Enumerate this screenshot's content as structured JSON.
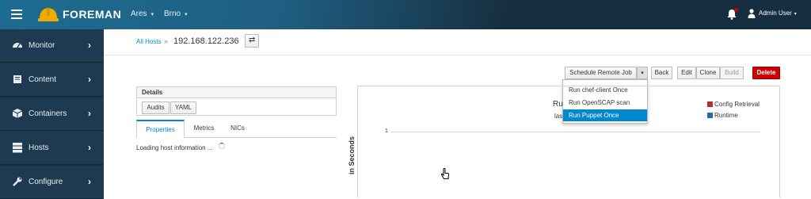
{
  "header": {
    "brand": "FOREMAN",
    "organization": "Ares",
    "location": "Brno",
    "user": "Admin User"
  },
  "sidebar": {
    "items": [
      {
        "label": "Monitor",
        "icon": "dashboard-icon"
      },
      {
        "label": "Content",
        "icon": "book-icon"
      },
      {
        "label": "Containers",
        "icon": "cube-icon"
      },
      {
        "label": "Hosts",
        "icon": "server-icon"
      },
      {
        "label": "Configure",
        "icon": "wrench-icon"
      }
    ]
  },
  "breadcrumb": {
    "parent": "All Hosts",
    "separator": "»",
    "current": "192.168.122.236"
  },
  "toolbar": {
    "schedule_label": "Schedule Remote Job",
    "back_label": "Back",
    "edit_label": "Edit",
    "clone_label": "Clone",
    "build_label": "Build",
    "delete_label": "Delete"
  },
  "dropdown": {
    "items": [
      {
        "label": "Run chef-client Once",
        "active": false
      },
      {
        "label": "Run OpenSCAP scan",
        "active": false
      },
      {
        "label": "Run Puppet Once",
        "active": true
      }
    ]
  },
  "details": {
    "heading": "Details",
    "audits_label": "Audits",
    "yaml_label": "YAML"
  },
  "tabs": [
    {
      "label": "Properties",
      "active": true
    },
    {
      "label": "Metrics",
      "active": false
    },
    {
      "label": "NICs",
      "active": false
    }
  ],
  "loading_text": "Loading host information ...",
  "chart": {
    "title_partial": "Ru",
    "subtitle_partial": "las",
    "y_tick": "1",
    "y_axis_label_partial": "in Seconds",
    "legend": [
      {
        "label": "Config Retrieval",
        "color": "#b03030"
      },
      {
        "label": "Runtime",
        "color": "#2a6aa0"
      }
    ]
  },
  "colors": {
    "topbar": "#162e3f",
    "sidebar_item": "#1d3a50",
    "link": "#0088ce",
    "danger": "#cc0000"
  }
}
